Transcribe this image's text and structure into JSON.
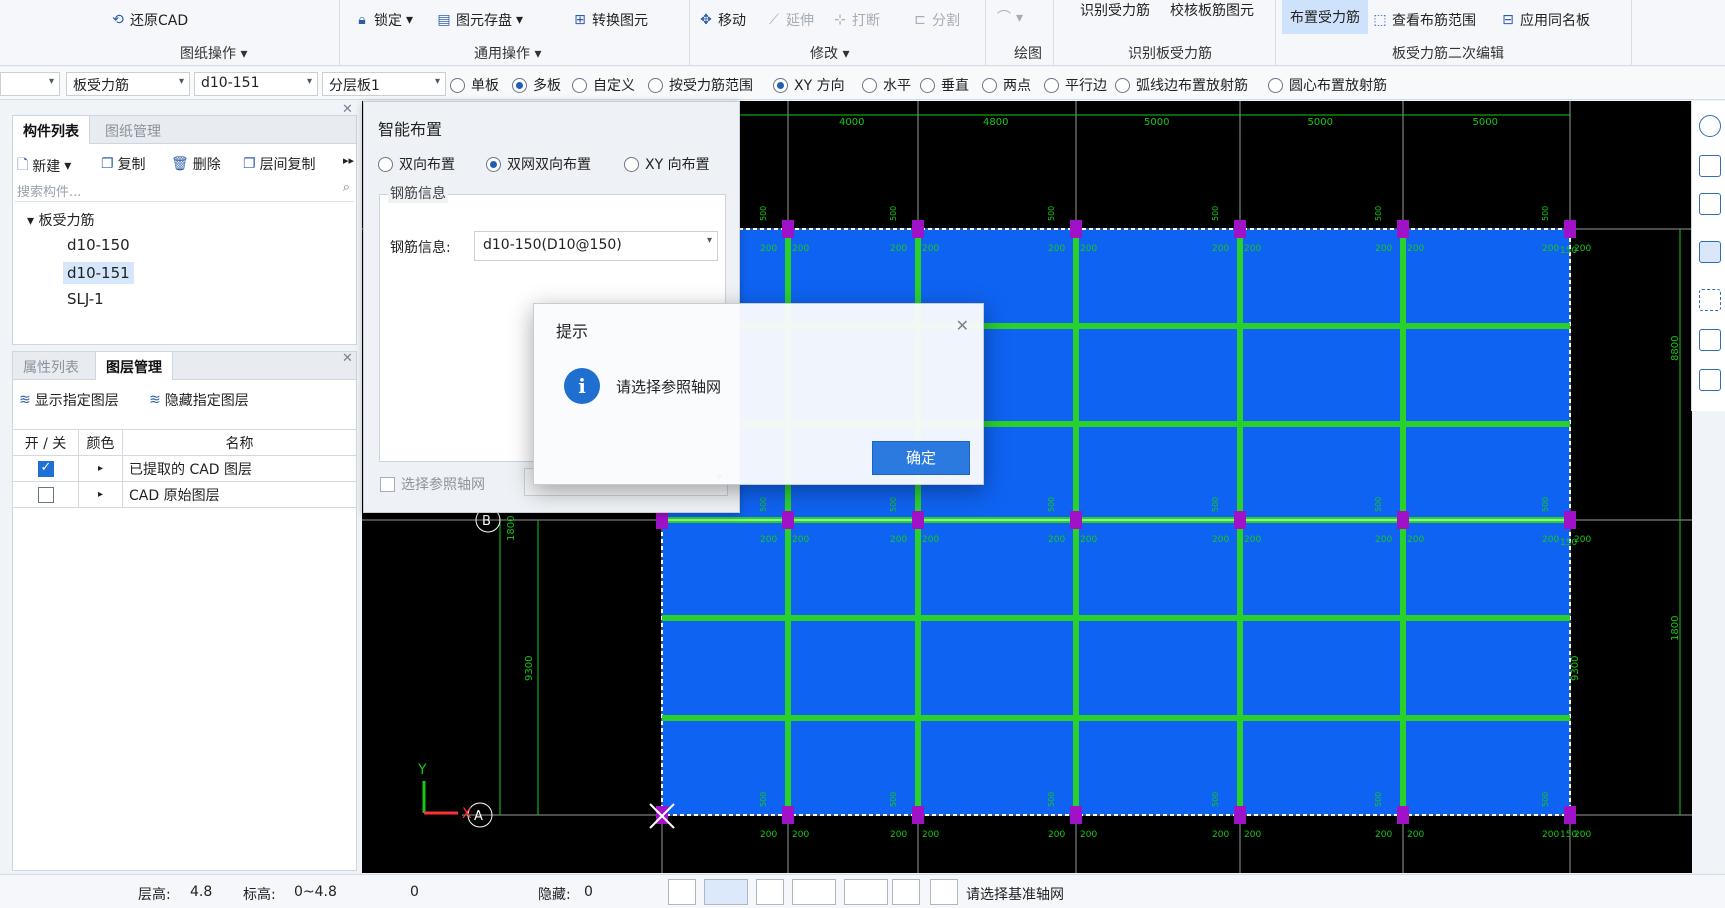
{
  "ribbon": {
    "restore_cad": "还原CAD",
    "group_drawing_ops": "图纸操作",
    "lock": "锁定",
    "save_element": "图元存盘",
    "convert_element": "转换图元",
    "group_general_ops": "通用操作",
    "move": "移动",
    "extend": "延伸",
    "break": "打断",
    "split": "分割",
    "group_modify": "修改",
    "group_draw": "绘图",
    "identify_rebar": "识别受力筋",
    "check_rebar": "校核板筋图元",
    "group_identify": "识别板受力筋",
    "place_rebar": "布置受力筋",
    "view_range": "查看布筋范围",
    "apply_same_name": "应用同名板",
    "group_secondary_edit": "板受力筋二次编辑"
  },
  "options": {
    "combo_type": "板受力筋",
    "combo_name": "d10-151",
    "combo_layer": "分层板1",
    "radios": [
      {
        "label": "单板",
        "checked": false
      },
      {
        "label": "多板",
        "checked": true
      },
      {
        "label": "自定义",
        "checked": false
      },
      {
        "label": "按受力筋范围",
        "checked": false
      },
      {
        "label": "XY 方向",
        "checked": true
      },
      {
        "label": "水平",
        "checked": false
      },
      {
        "label": "垂直",
        "checked": false
      },
      {
        "label": "两点",
        "checked": false
      },
      {
        "label": "平行边",
        "checked": false
      },
      {
        "label": "弧线边布置放射筋",
        "checked": false
      },
      {
        "label": "圆心布置放射筋",
        "checked": false
      }
    ]
  },
  "component_panel": {
    "tab_list": "构件列表",
    "tab_drawing": "图纸管理",
    "new": "新建",
    "copy": "复制",
    "delete": "删除",
    "floor_copy": "层间复制",
    "search_placeholder": "搜索构件...",
    "tree_root": "板受力筋",
    "items": [
      "d10-150",
      "d10-151",
      "SLJ-1"
    ],
    "selected": "d10-151"
  },
  "layer_panel": {
    "tab_props": "属性列表",
    "tab_layers": "图层管理",
    "show_layer": "显示指定图层",
    "hide_layer": "隐藏指定图层",
    "col_toggle": "开 / 关",
    "col_color": "颜色",
    "col_name": "名称",
    "rows": [
      {
        "checked": true,
        "name": "已提取的 CAD 图层"
      },
      {
        "checked": false,
        "name": "CAD 原始图层"
      }
    ]
  },
  "smart_dialog": {
    "title": "智能布置",
    "radio_bidirectional": "双向布置",
    "radio_double_net": "双网双向布置",
    "radio_xy": "XY 向布置",
    "selected": "双网双向布置",
    "legend": "钢筋信息",
    "rebar_label": "钢筋信息:",
    "rebar_value": "d10-150(D10@150)",
    "select_axis": "选择参照轴网"
  },
  "modal": {
    "title": "提示",
    "message": "请选择参照轴网",
    "ok": "确定"
  },
  "canvas": {
    "dims_top": [
      "4000",
      "4800",
      "5000",
      "5000",
      "5000"
    ],
    "axis_A": "A",
    "axis_B": "B",
    "label_x": "X",
    "label_y": "Y",
    "dim_right_top": "8800",
    "dim_right_mid": "1800",
    "dim_right_bot": "9300",
    "dim_left": "9300",
    "dim_left_mid": "1800",
    "rebar_label": "200",
    "rebar_small": "150",
    "rebar_vert": "500"
  },
  "status": {
    "floor_height_label": "层高:",
    "floor_height": "4.8",
    "elevation_label": "标高:",
    "elevation": "0~4.8",
    "zero": "0",
    "hidden_label": "隐藏:",
    "hidden": "0",
    "prompt": "请选择基准轴网"
  },
  "colors": {
    "slab": "#0f63f2",
    "rebar": "#2bd12b",
    "node": "#a012c8",
    "axis": "#18c818"
  }
}
